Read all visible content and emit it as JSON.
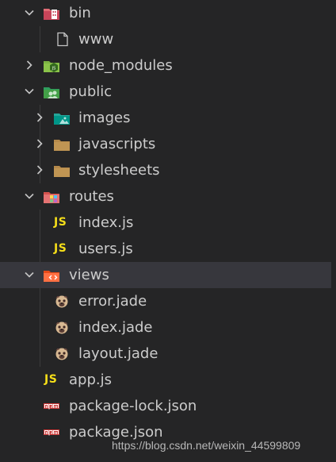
{
  "explorer": {
    "items": [
      {
        "label": "bin",
        "kind": "folder",
        "state": "expanded",
        "icon": "bin-folder-icon"
      },
      {
        "label": "www",
        "kind": "file",
        "icon": "file-icon"
      },
      {
        "label": "node_modules",
        "kind": "folder",
        "state": "collapsed",
        "icon": "node-folder-icon"
      },
      {
        "label": "public",
        "kind": "folder",
        "state": "expanded",
        "icon": "public-folder-icon"
      },
      {
        "label": "images",
        "kind": "folder",
        "state": "collapsed",
        "icon": "images-folder-icon"
      },
      {
        "label": "javascripts",
        "kind": "folder",
        "state": "collapsed",
        "icon": "folder-icon"
      },
      {
        "label": "stylesheets",
        "kind": "folder",
        "state": "collapsed",
        "icon": "folder-icon"
      },
      {
        "label": "routes",
        "kind": "folder",
        "state": "expanded",
        "icon": "routes-folder-icon"
      },
      {
        "label": "index.js",
        "kind": "file",
        "icon": "js-file-icon"
      },
      {
        "label": "users.js",
        "kind": "file",
        "icon": "js-file-icon"
      },
      {
        "label": "views",
        "kind": "folder",
        "state": "expanded",
        "selected": true,
        "icon": "views-folder-icon"
      },
      {
        "label": "error.jade",
        "kind": "file",
        "icon": "jade-file-icon"
      },
      {
        "label": "index.jade",
        "kind": "file",
        "icon": "jade-file-icon"
      },
      {
        "label": "layout.jade",
        "kind": "file",
        "icon": "jade-file-icon"
      },
      {
        "label": "app.js",
        "kind": "file",
        "icon": "js-file-icon"
      },
      {
        "label": "package-lock.json",
        "kind": "file",
        "icon": "npm-file-icon"
      },
      {
        "label": "package.json",
        "kind": "file",
        "icon": "npm-file-icon"
      }
    ],
    "js_badge": "JS"
  },
  "watermark": "https://blog.csdn.net/weixin_44599809",
  "colors": {
    "background": "#252526",
    "selected_row": "#37373d",
    "text": "#cccccc",
    "js_badge": "#f5de19"
  }
}
